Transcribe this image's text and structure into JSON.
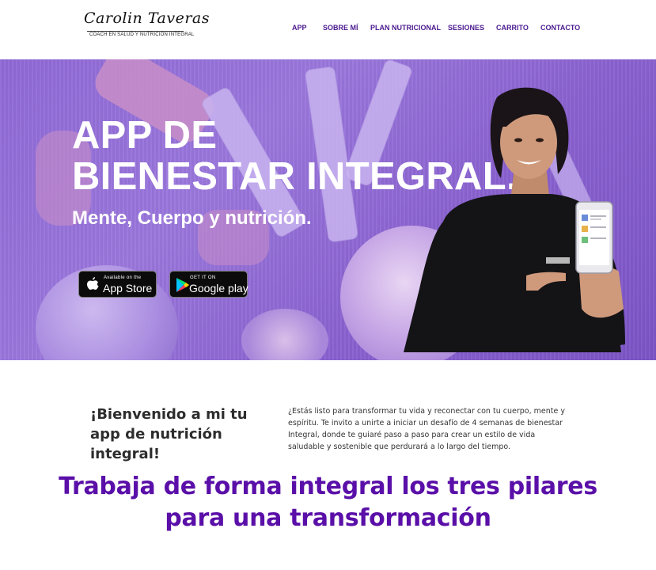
{
  "header": {
    "logo_script": "Carolin Taveras",
    "logo_tagline": "COACH EN SALUD Y NUTRICION INTEGRAL",
    "nav": [
      {
        "label": "APP"
      },
      {
        "label": "SOBRE MÍ"
      },
      {
        "label": "PLAN NUTRICIONAL"
      },
      {
        "label": "SESIONES"
      },
      {
        "label": "CARRITO"
      },
      {
        "label": "CONTACTO"
      }
    ],
    "nav_color": "#4b1a8f"
  },
  "hero": {
    "title_line1": "APP DE",
    "title_line2": "BIENESTAR INTEGRAL.",
    "subtitle": "Mente, Cuerpo y nutrición.",
    "app_store": {
      "small": "Available on the",
      "big": "App Store"
    },
    "google_play": {
      "small": "GET IT ON",
      "big": "Google play"
    },
    "overlay_color": "#8f69d6"
  },
  "welcome": {
    "heading": "¡Bienvenido a mi tu app de nutrición integral!",
    "body": "¿Estás listo para transformar tu vida y reconectar con tu cuerpo, mente y espíritu. Te invito a unirte a iniciar un desafío de 4 semanas de bienestar Integral, donde te guiaré paso a paso para crear un estilo de vida saludable y sostenible que perdurará a lo largo del tiempo."
  },
  "pillars": {
    "line1": "Trabaja de forma integral los tres pilares",
    "line2": "para una transformación",
    "color": "#5a0fa8"
  }
}
